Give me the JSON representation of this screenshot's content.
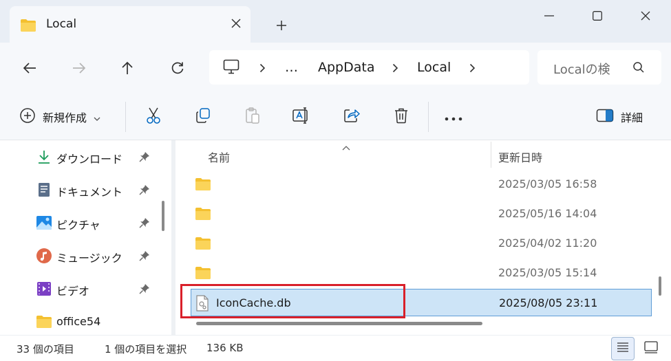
{
  "window": {
    "tab_title": "Local",
    "colors": {
      "titlebar": "#e9eef5",
      "accent": "#0067c0",
      "selection": "#cde4f7",
      "highlight": "#d9202a",
      "folder": "#f4c030"
    }
  },
  "address": {
    "items": [
      "…",
      "AppData",
      "Local"
    ]
  },
  "search": {
    "placeholder": "Localの検"
  },
  "toolbar": {
    "new_label": "新規作成",
    "details_label": "詳細"
  },
  "sidebar": {
    "items": [
      {
        "label": "ダウンロード",
        "icon": "download-icon",
        "pinned": true
      },
      {
        "label": "ドキュメント",
        "icon": "document-icon",
        "pinned": true
      },
      {
        "label": "ピクチャ",
        "icon": "picture-icon",
        "pinned": true
      },
      {
        "label": "ミュージック",
        "icon": "music-icon",
        "pinned": true
      },
      {
        "label": "ビデオ",
        "icon": "video-icon",
        "pinned": true
      },
      {
        "label": "office54",
        "icon": "folder-icon",
        "pinned": false
      }
    ]
  },
  "filelist": {
    "columns": {
      "name": "名前",
      "date": "更新日時"
    },
    "rows": [
      {
        "name": "",
        "date": "2025/03/05 16:58",
        "type": "folder"
      },
      {
        "name": "",
        "date": "2025/05/16 14:04",
        "type": "folder"
      },
      {
        "name": "",
        "date": "2025/04/02 11:20",
        "type": "folder"
      },
      {
        "name": "",
        "date": "2025/03/05 15:14",
        "type": "folder"
      },
      {
        "name": "IconCache.db",
        "date": "2025/08/05 23:11",
        "type": "file",
        "selected": true
      }
    ]
  },
  "status": {
    "item_count": "33 個の項目",
    "selection": "1 個の項目を選択",
    "size": "136 KB"
  }
}
